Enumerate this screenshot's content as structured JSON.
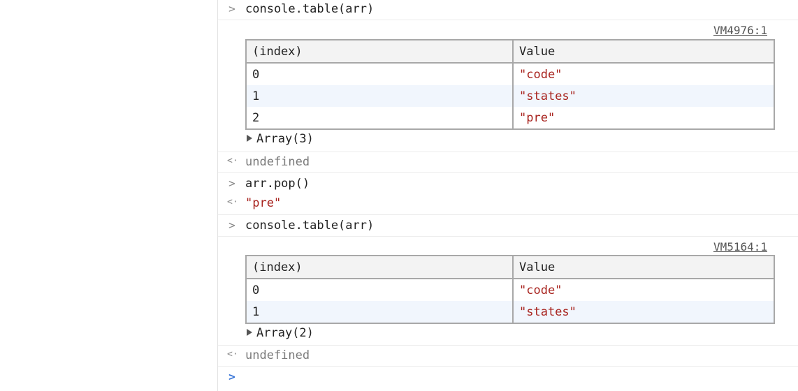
{
  "glyphs": {
    "input": ">",
    "output": "<·",
    "prompt": ">"
  },
  "entries": [
    {
      "command": "console.table(arr)"
    },
    {
      "source_link": "VM4976:1",
      "table": {
        "headers": [
          "(index)",
          "Value"
        ],
        "rows": [
          {
            "index": "0",
            "value": "\"code\""
          },
          {
            "index": "1",
            "value": "\"states\""
          },
          {
            "index": "2",
            "value": "\"pre\""
          }
        ]
      },
      "expander_label": "Array(3)"
    },
    {
      "result": "undefined"
    },
    {
      "command": "arr.pop()"
    },
    {
      "result": "\"pre\""
    },
    {
      "command": "console.table(arr)"
    },
    {
      "source_link": "VM5164:1",
      "table": {
        "headers": [
          "(index)",
          "Value"
        ],
        "rows": [
          {
            "index": "0",
            "value": "\"code\""
          },
          {
            "index": "1",
            "value": "\"states\""
          }
        ]
      },
      "expander_label": "Array(2)"
    },
    {
      "result": "undefined"
    }
  ],
  "colors": {
    "string": "#a8231e",
    "muted": "#7b7b7b",
    "prompt_blue": "#3b77d8",
    "even_row": "#f1f6fd"
  }
}
